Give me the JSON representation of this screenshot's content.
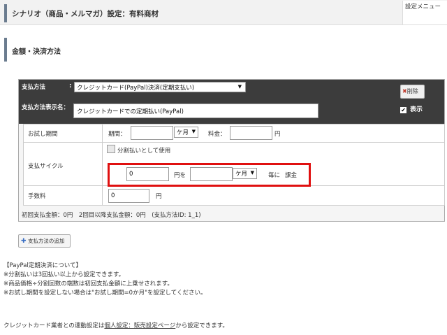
{
  "header": {
    "title": "シナリオ（商品・メルマガ）設定：有料商材",
    "menu_label": "設定メニュー"
  },
  "section": {
    "title": "金額・決済方法"
  },
  "payment": {
    "method_label": "支払方法",
    "method_colon": ":",
    "method_value": "クレジットカード(PayPal)決済(定期支払い)",
    "display_name_label": "支払方法表示名：",
    "display_name_value": "クレジットカードでの定期払い(PayPal)",
    "delete_label": "削除",
    "show_label": "表示",
    "show_checked": true
  },
  "trial": {
    "row_label": "お試し期間",
    "period_label": "期間：",
    "period_value": "",
    "period_unit": "ケ月",
    "fee_label": "料金：",
    "fee_value": "",
    "fee_unit": "円"
  },
  "cycle": {
    "row_label": "支払サイクル",
    "split_label": "分割払いとして使用",
    "amount_value": "0",
    "amount_unit": "円を",
    "interval_value": "",
    "interval_unit": "ケ月",
    "every_label": "毎に",
    "charge_label": "課金"
  },
  "fee": {
    "row_label": "手数料",
    "value": "0",
    "unit": "円"
  },
  "summary": "初回支払金額：0円　2回目以降支払金額：0円　(支払方法ID: 1_1)",
  "add_button": "支払方法の追加",
  "notes": [
    "【PayPal定期決済について】",
    "※分割払いは3回払い以上から設定できます。",
    "※商品価格÷分割回数の端数は初回支払金額に上乗せされます。",
    "※お試し期間を設定しない場合は\"お試し期間=0か月\"を設定してください。"
  ],
  "footer": {
    "prefix": "クレジットカード業者との連動設定は",
    "link": "個人設定：販売設定ページ",
    "suffix": "から設定できます。"
  },
  "colors": {
    "accent": "#6b7c8f",
    "header_dark": "#3c3c3c",
    "highlight": "#e01010",
    "add_icon": "#3a6fc4"
  }
}
